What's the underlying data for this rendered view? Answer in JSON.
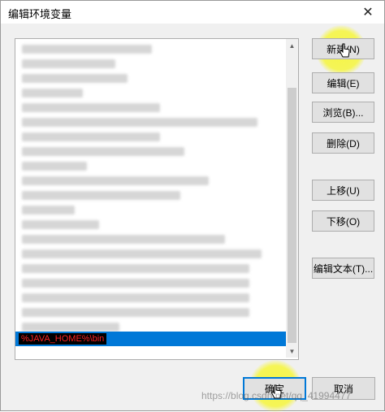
{
  "window": {
    "title": "编辑环境变量",
    "close_glyph": "✕"
  },
  "path_list": {
    "selected_entry": "%JAVA_HOME%\\bin"
  },
  "buttons": {
    "new": "新建(N)",
    "edit": "编辑(E)",
    "browse": "浏览(B)...",
    "delete": "删除(D)",
    "move_up": "上移(U)",
    "move_down": "下移(O)",
    "edit_text": "编辑文本(T)...",
    "ok": "确定",
    "cancel": "取消"
  },
  "watermark": "https://blog.csdn.net/qq_41994477",
  "colors": {
    "selection": "#0078d7",
    "highlight": "#f6f63c",
    "edit_text": "#ff2222"
  }
}
